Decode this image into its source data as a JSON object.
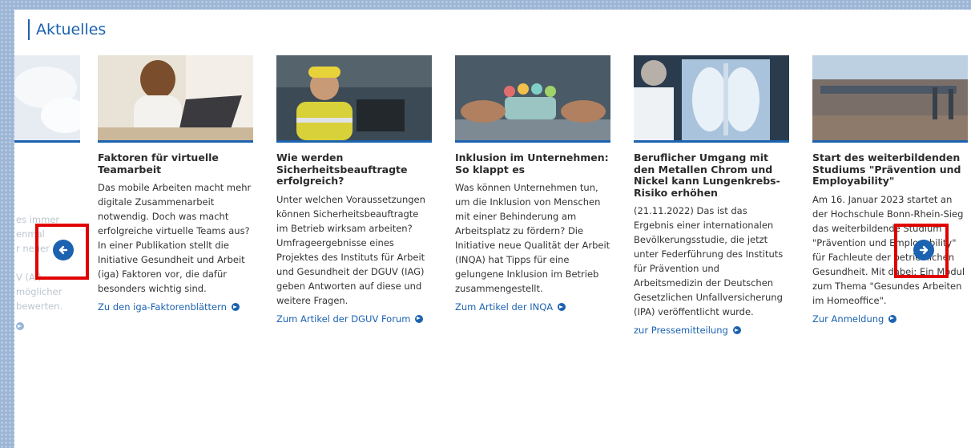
{
  "section": {
    "title": "Aktuelles"
  },
  "partial_card": {
    "lines": [
      "es immer",
      "enmal",
      "r neuer",
      "V (AI)",
      "möglicher",
      "bewerten."
    ]
  },
  "cards": [
    {
      "title": "Faktoren für virtuelle Teamarbeit",
      "text": "Das mobile Arbeiten macht mehr digitale Zusammenarbeit notwendig. Doch was macht erfolgreiche virtuelle Teams aus? In einer Publikation stellt die Initiative Gesundheit und Arbeit (iga) Faktoren vor, die dafür besonders wichtig sind.",
      "link": "Zu den iga-Faktorenblättern"
    },
    {
      "title": "Wie werden Sicherheitsbeauftragte erfolgreich?",
      "text": "Unter welchen Voraussetzungen können Sicherheitsbeauftragte im Betrieb wirksam arbeiten? Umfrageergebnisse eines Projektes des Instituts für Arbeit und Gesundheit der DGUV (IAG) geben Antworten auf diese und weitere Fragen.",
      "link": "Zum Artikel der DGUV Forum"
    },
    {
      "title": "Inklusion im Unternehmen: So klappt es",
      "text": "Was können Unternehmen tun, um die Inklusion von Menschen mit einer Behinderung am Arbeitsplatz zu fördern? Die Initiative neue Qualität der Arbeit (INQA) hat Tipps für eine gelungene Inklusion im Betrieb zusammengestellt.",
      "link": "Zum Artikel der INQA"
    },
    {
      "title": "Beruflicher Umgang mit den Metallen Chrom und Nickel kann Lungenkrebs-Risiko erhöhen",
      "text": "(21.11.2022) Das ist das Ergebnis einer internationalen Bevölkerungsstudie, die jetzt unter Federführung des Instituts für Prävention und Arbeitsmedizin der Deutschen Gesetzlichen Unfallversicherung (IPA) veröffentlicht wurde.",
      "link": "zur Pressemitteilung"
    },
    {
      "title": "Start des weiterbildenden Studiums \"Prävention und Employability\"",
      "text": "Am 16. Januar 2023 startet an der Hochschule Bonn-Rhein-Sieg das weiterbildende Studium \"Prävention und Employability\" für Fachleute der betrieblichen Gesundheit. Mit dabei: Ein Modul zum Thema \"Gesundes Arbeiten im Homeoffice\".",
      "link": "Zur Anmeldung"
    }
  ],
  "nav": {
    "prev_icon": "arrow-left-icon",
    "next_icon": "arrow-right-icon"
  },
  "colors": {
    "accent": "#1b62b0",
    "highlight": "#e00000"
  }
}
